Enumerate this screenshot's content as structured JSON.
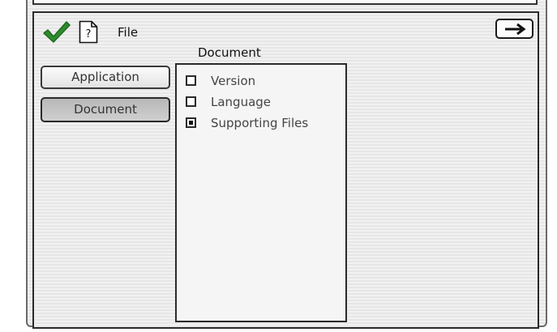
{
  "header": {
    "title": "File",
    "icons": [
      "checkmark-icon",
      "document-question-icon",
      "arrow-right-icon"
    ],
    "checkmark_color": "#2e8b2e"
  },
  "section": {
    "title": "Document"
  },
  "side_buttons": [
    {
      "label": "Application",
      "selected": false
    },
    {
      "label": "Document",
      "selected": true
    }
  ],
  "options": [
    {
      "label": "Version",
      "checked": false
    },
    {
      "label": "Language",
      "checked": false
    },
    {
      "label": "Supporting Files",
      "checked": true
    }
  ]
}
